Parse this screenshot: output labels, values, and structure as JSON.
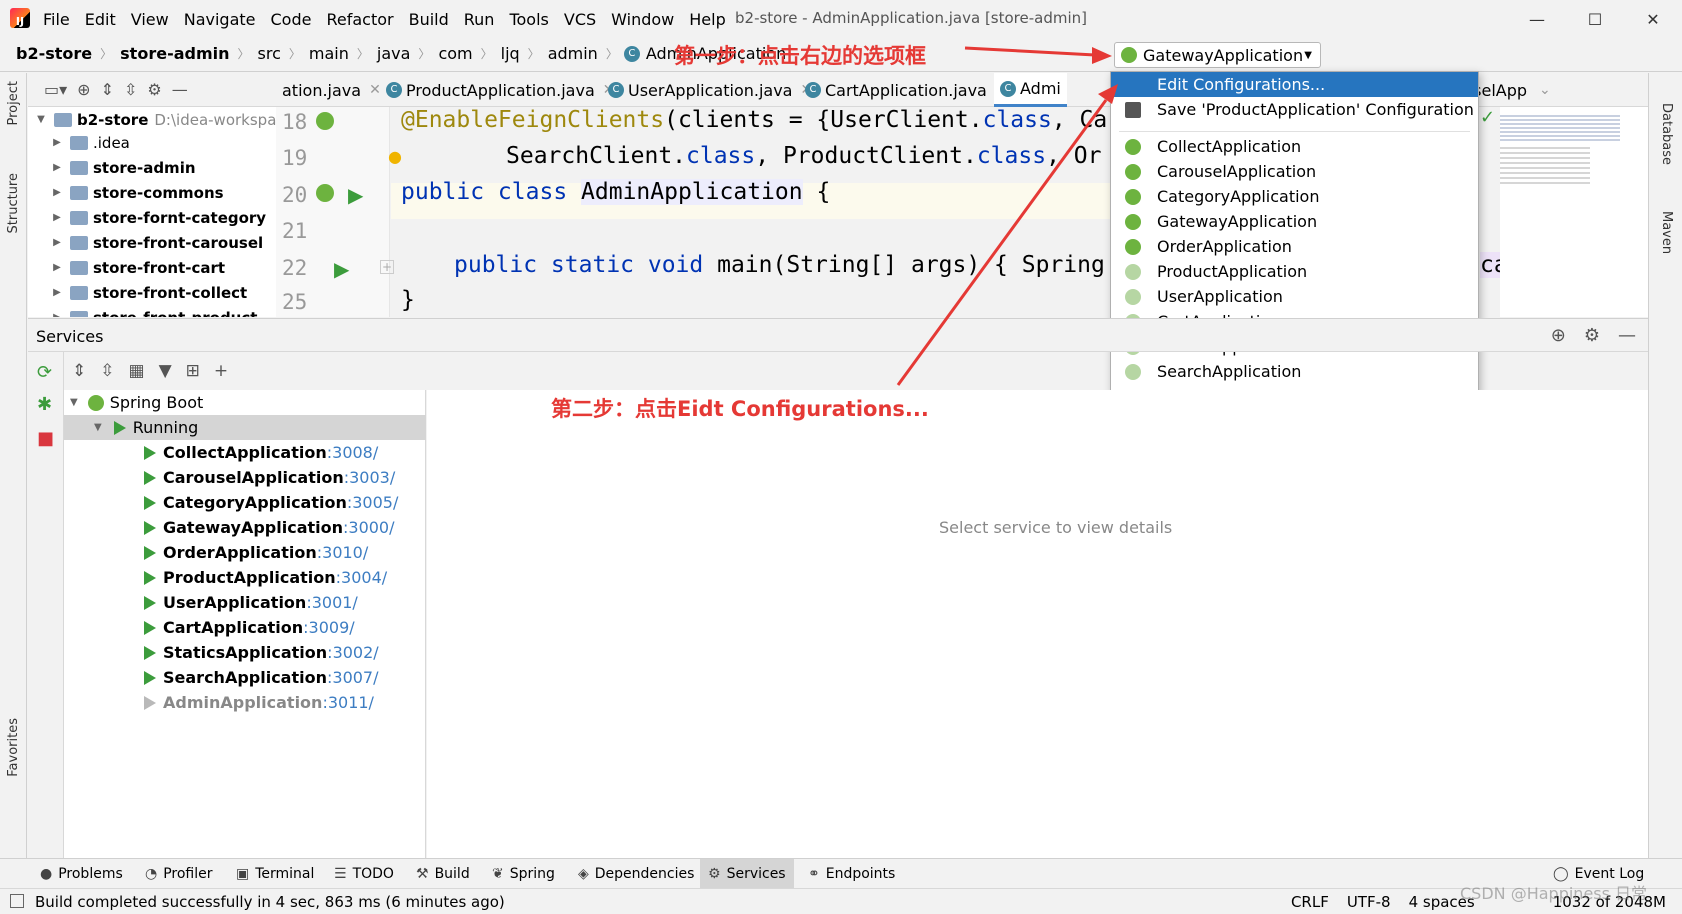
{
  "menu": [
    "File",
    "Edit",
    "View",
    "Navigate",
    "Code",
    "Refactor",
    "Build",
    "Run",
    "Tools",
    "VCS",
    "Window",
    "Help"
  ],
  "window_title": "b2-store - AdminApplication.java [store-admin]",
  "window_controls": {
    "minimize": "—",
    "maximize": "☐",
    "close": "✕"
  },
  "breadcrumb": [
    "b2-store",
    "store-admin",
    "src",
    "main",
    "java",
    "com",
    "ljq",
    "admin",
    "AdminApplication"
  ],
  "annotation_step1": "第一步：点击右边的选项框",
  "annotation_step2": "第二步：点击Eidt Configurations...",
  "run_config": "GatewayApplication",
  "project_tree": {
    "root": "b2-store",
    "root_path": "D:\\idea-workspa",
    "items": [
      ".idea",
      "store-admin",
      "store-commons",
      "store-fornt-category",
      "store-front-carousel",
      "store-front-cart",
      "store-front-collect",
      "store-front-product"
    ]
  },
  "editor_tabs": [
    "ation.java",
    "ProductApplication.java",
    "UserApplication.java",
    "CartApplication.java",
    "Admi",
    "CarouselApp"
  ],
  "code": {
    "line_numbers": [
      "18",
      "19",
      "20",
      "21",
      "22",
      "25"
    ],
    "l18_ann": "@EnableFeignClients",
    "l18_rest": "(clients = {UserClient.",
    "l18_kw": "class",
    "l18_tail": ", Ca",
    "l19_a": "SearchClient.",
    "l19_kw1": "class",
    "l19_b": ", ProductClient.",
    "l19_kw2": "class",
    "l19_tail": ", Or",
    "l20_kw": "public class",
    "l20_name": "AdminApplication",
    "l20_tail": " {",
    "l22_kw": "public static void",
    "l22_rest": "main(String[] args) { Spring",
    "l22_tail": "ca",
    "l25": "}"
  },
  "config_menu": {
    "edit": "Edit Configurations...",
    "save": "Save 'ProductApplication' Configuration",
    "apps": [
      "CollectApplication",
      "CarouselApplication",
      "CategoryApplication",
      "GatewayApplication",
      "OrderApplication",
      "ProductApplication",
      "UserApplication",
      "CartApplication",
      "StaticsApplication",
      "SearchApplication"
    ]
  },
  "services": {
    "title": "Services",
    "spring_boot": "Spring Boot",
    "running": "Running",
    "apps": [
      {
        "name": "CollectApplication",
        "port": ":3008/"
      },
      {
        "name": "CarouselApplication",
        "port": ":3003/"
      },
      {
        "name": "CategoryApplication",
        "port": ":3005/"
      },
      {
        "name": "GatewayApplication",
        "port": ":3000/"
      },
      {
        "name": "OrderApplication",
        "port": ":3010/"
      },
      {
        "name": "ProductApplication",
        "port": ":3004/"
      },
      {
        "name": "UserApplication",
        "port": ":3001/"
      },
      {
        "name": "CartApplication",
        "port": ":3009/"
      },
      {
        "name": "StaticsApplication",
        "port": ":3002/"
      },
      {
        "name": "SearchApplication",
        "port": ":3007/"
      },
      {
        "name": "AdminApplication",
        "port": ":3011/"
      }
    ],
    "details_placeholder": "Select service to view details"
  },
  "left_strip": [
    "Project",
    "Structure",
    "Favorites"
  ],
  "right_strip": [
    "Database",
    "Maven"
  ],
  "bottom_tabs": [
    "Problems",
    "Profiler",
    "Terminal",
    "TODO",
    "Build",
    "Spring",
    "Dependencies",
    "Services",
    "Endpoints",
    "Event Log"
  ],
  "status": {
    "message": "Build completed successfully in 4 sec, 863 ms (6 minutes ago)",
    "line_sep": "CRLF",
    "encoding": "UTF-8",
    "indent": "4 spaces",
    "memory": "1032 of 2048M"
  },
  "watermark": "CSDN @Happiness 日常",
  "colors": {
    "selection": "#2675bf",
    "annotation": "#e53935",
    "running_green": "#3c9c3c",
    "port_blue": "#3d7dc2"
  }
}
